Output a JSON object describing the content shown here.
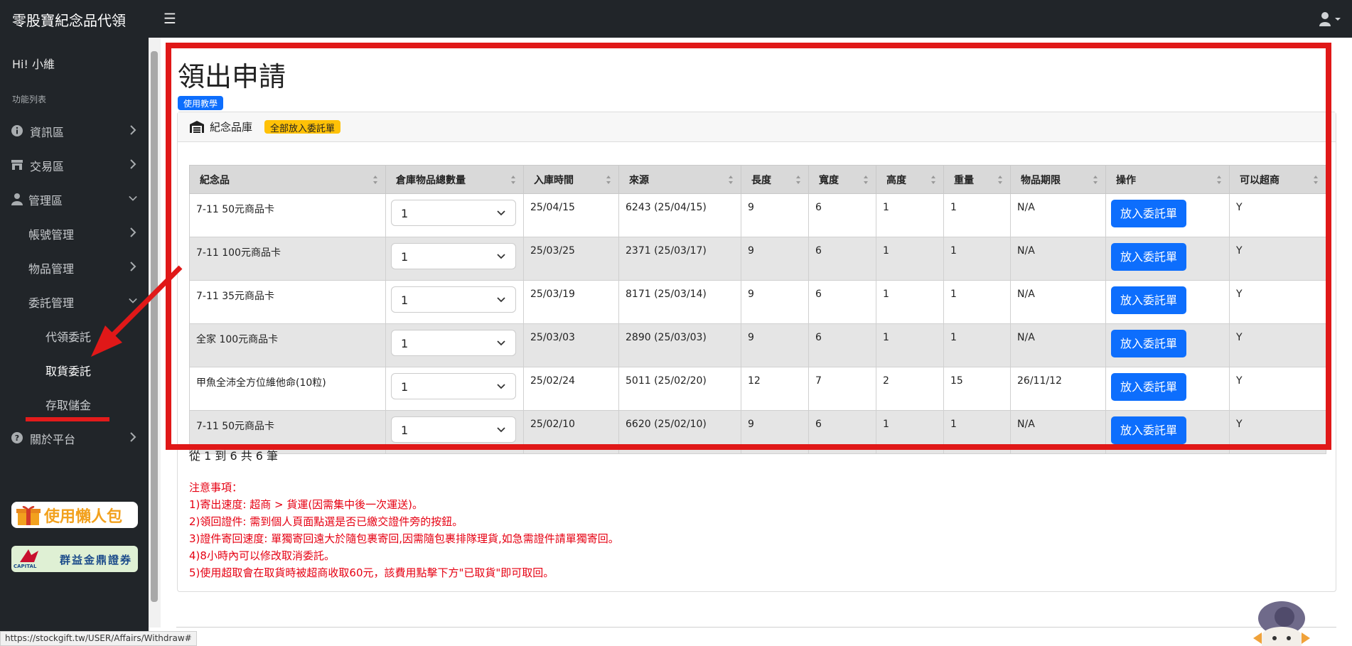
{
  "app": {
    "brand": "零股寶紀念品代領",
    "menu_icon": "☰"
  },
  "sidebar": {
    "greeting": "Hi! 小維",
    "section_title": "功能列表",
    "items": [
      {
        "label": "資訊區",
        "icon": "info-icon"
      },
      {
        "label": "交易區",
        "icon": "store-icon"
      },
      {
        "label": "管理區",
        "icon": "user-icon"
      },
      {
        "label": "帳號管理"
      },
      {
        "label": "物品管理"
      },
      {
        "label": "委託管理"
      },
      {
        "label": "代領委託"
      },
      {
        "label": "取貨委託"
      },
      {
        "label": "存取儲金"
      },
      {
        "label": "關於平台",
        "icon": "question-icon"
      }
    ],
    "promo1": "使用懶人包",
    "promo2": "群益金鼎證券",
    "promo2_caption": "CAPITAL"
  },
  "main": {
    "title": "領出申請",
    "tutorial_badge": "使用教學",
    "warehouse_label": "紀念品庫",
    "put_all_badge": "全部放入委託單",
    "columns": [
      "紀念品",
      "倉庫物品總數量",
      "入庫時間",
      "來源",
      "長度",
      "寬度",
      "高度",
      "重量",
      "物品期限",
      "操作",
      "可以超商"
    ],
    "rows": [
      {
        "name": "7-11 50元商品卡",
        "qty": "1",
        "date": "25/04/15",
        "source": "6243 (25/04/15)",
        "length": "9",
        "width": "6",
        "height": "1",
        "weight": "1",
        "expiry": "N/A",
        "action": "放入委託單",
        "cvs": "Y"
      },
      {
        "name": "7-11 100元商品卡",
        "qty": "1",
        "date": "25/03/25",
        "source": "2371 (25/03/17)",
        "length": "9",
        "width": "6",
        "height": "1",
        "weight": "1",
        "expiry": "N/A",
        "action": "放入委託單",
        "cvs": "Y"
      },
      {
        "name": "7-11 35元商品卡",
        "qty": "1",
        "date": "25/03/19",
        "source": "8171 (25/03/14)",
        "length": "9",
        "width": "6",
        "height": "1",
        "weight": "1",
        "expiry": "N/A",
        "action": "放入委託單",
        "cvs": "Y"
      },
      {
        "name": "全家 100元商品卡",
        "qty": "1",
        "date": "25/03/03",
        "source": "2890 (25/03/03)",
        "length": "9",
        "width": "6",
        "height": "1",
        "weight": "1",
        "expiry": "N/A",
        "action": "放入委託單",
        "cvs": "Y"
      },
      {
        "name": "甲魚全沛全方位維他命(10粒)",
        "qty": "1",
        "date": "25/02/24",
        "source": "5011 (25/02/20)",
        "length": "12",
        "width": "7",
        "height": "2",
        "weight": "15",
        "expiry": "26/11/12",
        "action": "放入委託單",
        "cvs": "Y"
      },
      {
        "name": "7-11 50元商品卡",
        "qty": "1",
        "date": "25/02/10",
        "source": "6620 (25/02/10)",
        "length": "9",
        "width": "6",
        "height": "1",
        "weight": "1",
        "expiry": "N/A",
        "action": "放入委託單",
        "cvs": "Y"
      }
    ],
    "paging_info": "從 1 到 6 共 6 筆",
    "notes": [
      "注意事項：",
      "1)寄出速度: 超商 > 貨運(因需集中後一次運送)。",
      "2)領回證件: 需到個人頁面點選是否已繳交證件旁的按鈕。",
      "3)證件寄回速度: 單獨寄回遠大於隨包裹寄回,因需隨包裹排隊理貨,如急需證件請單獨寄回。",
      "4)8小時內可以修改取消委託。",
      "5)使用超取會在取貨時被超商收取60元，該費用點擊下方\"已取貨\"即可取回。"
    ]
  },
  "status_url": "https://stockgift.tw/USER/Affairs/Withdraw#",
  "colors": {
    "primary": "#0d6efd",
    "warning": "#ffc107",
    "annotation_red": "#e01818",
    "note_red": "#e60012",
    "dark": "#212529"
  }
}
